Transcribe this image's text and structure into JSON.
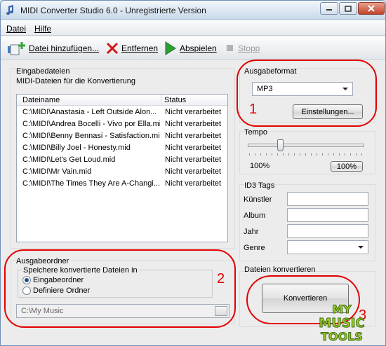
{
  "window": {
    "title": "MIDI Converter Studio 6.0 -  Unregistrierte Version"
  },
  "menu": {
    "items": [
      {
        "label": "Datei"
      },
      {
        "label": "Hilfe"
      }
    ]
  },
  "toolbar": {
    "add_label": "Datei hinzufügen...",
    "remove_label": "Entfernen",
    "play_label": "Abspielen",
    "stop_label": "Stopp"
  },
  "input": {
    "group_title": "Eingabedateien",
    "subtitle": "MIDI-Dateien für die Konvertierung",
    "columns": [
      "Dateiname",
      "Status"
    ],
    "rows": [
      {
        "file": "C:\\MIDI\\Anastasia - Left Outside Alon...",
        "status": "Nicht verarbeitet"
      },
      {
        "file": "C:\\MIDI\\Andrea Bocelli - Vivo por Ella.mid",
        "status": "Nicht verarbeitet"
      },
      {
        "file": "C:\\MIDI\\Benny Bennasi - Satisfaction.mid",
        "status": "Nicht verarbeitet"
      },
      {
        "file": "C:\\MIDI\\Billy Joel - Honesty.mid",
        "status": "Nicht verarbeitet"
      },
      {
        "file": "C:\\MIDI\\Let's Get Loud.mid",
        "status": "Nicht verarbeitet"
      },
      {
        "file": "C:\\MIDI\\Mr Vain.mid",
        "status": "Nicht verarbeitet"
      },
      {
        "file": "C:\\MIDI\\The Times They Are A-Changi...",
        "status": "Nicht verarbeitet"
      }
    ]
  },
  "output_format": {
    "title": "Ausgabeformat",
    "selected": "MP3",
    "settings_label": "Einstellungen..."
  },
  "tempo": {
    "title": "Tempo",
    "value_label": "100%",
    "reset_label": "100%",
    "level_fraction": 0.26
  },
  "id3": {
    "title": "ID3 Tags",
    "artist_label": "Künstler",
    "album_label": "Album",
    "year_label": "Jahr",
    "genre_label": "Genre",
    "artist_value": "",
    "album_value": "",
    "year_value": "",
    "genre_value": ""
  },
  "output_folder": {
    "title": "Ausgabeordner",
    "save_group_label": "Speichere konvertierte Dateien in",
    "option_input": "Eingabeordner",
    "option_define": "Definiere Ordner",
    "selected_option": "Eingabeordner",
    "path": "C:\\My Music"
  },
  "convert": {
    "title": "Dateien konvertieren",
    "button_label": "Konvertieren"
  },
  "annotations": {
    "mark_1": "1",
    "mark_2": "2",
    "mark_3": "3",
    "color": "#e30000"
  },
  "watermark": {
    "lines": [
      "MY",
      "MUSIC",
      "TOOLS"
    ],
    "color": "#9ccc2b"
  }
}
